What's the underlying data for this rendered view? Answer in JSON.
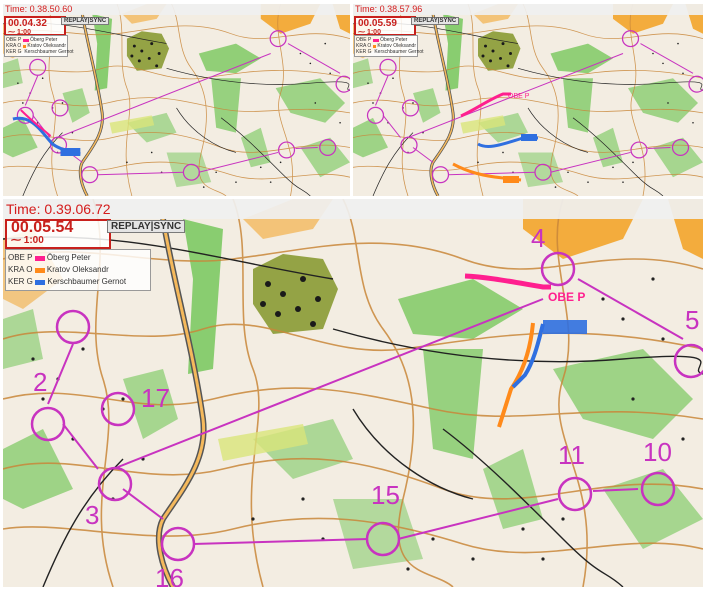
{
  "panels": [
    {
      "time": "Time: 0.38.50.60",
      "clock": "00.04.32",
      "scale": "1:00"
    },
    {
      "time": "Time: 0.38.57.96",
      "clock": "00.05.59",
      "scale": "1:00"
    },
    {
      "time": "Time: 0.39.06.72",
      "clock": "00.05.54",
      "scale": "1:00"
    }
  ],
  "replay_label": "REPLAY",
  "sync_label": "SYNC",
  "runners": [
    {
      "code": "OBE P",
      "name": "Öberg Peter",
      "color": "#ff1f8f"
    },
    {
      "code": "KRA O",
      "name": "Kratov Oleksandr",
      "color": "#ff8a1a"
    },
    {
      "code": "KER G",
      "name": "Kerschbaumer Gernot",
      "color": "#2f6fe0"
    }
  ],
  "track_tag": "OBE P",
  "controls": [
    "4",
    "5",
    "2",
    "17",
    "3",
    "15",
    "11",
    "10",
    "16"
  ],
  "colors": {
    "course": "#c833c0",
    "contour": "#c9873a",
    "forest": "#66c24a",
    "open": "#f2a020",
    "time_text": "#d41c1c"
  }
}
